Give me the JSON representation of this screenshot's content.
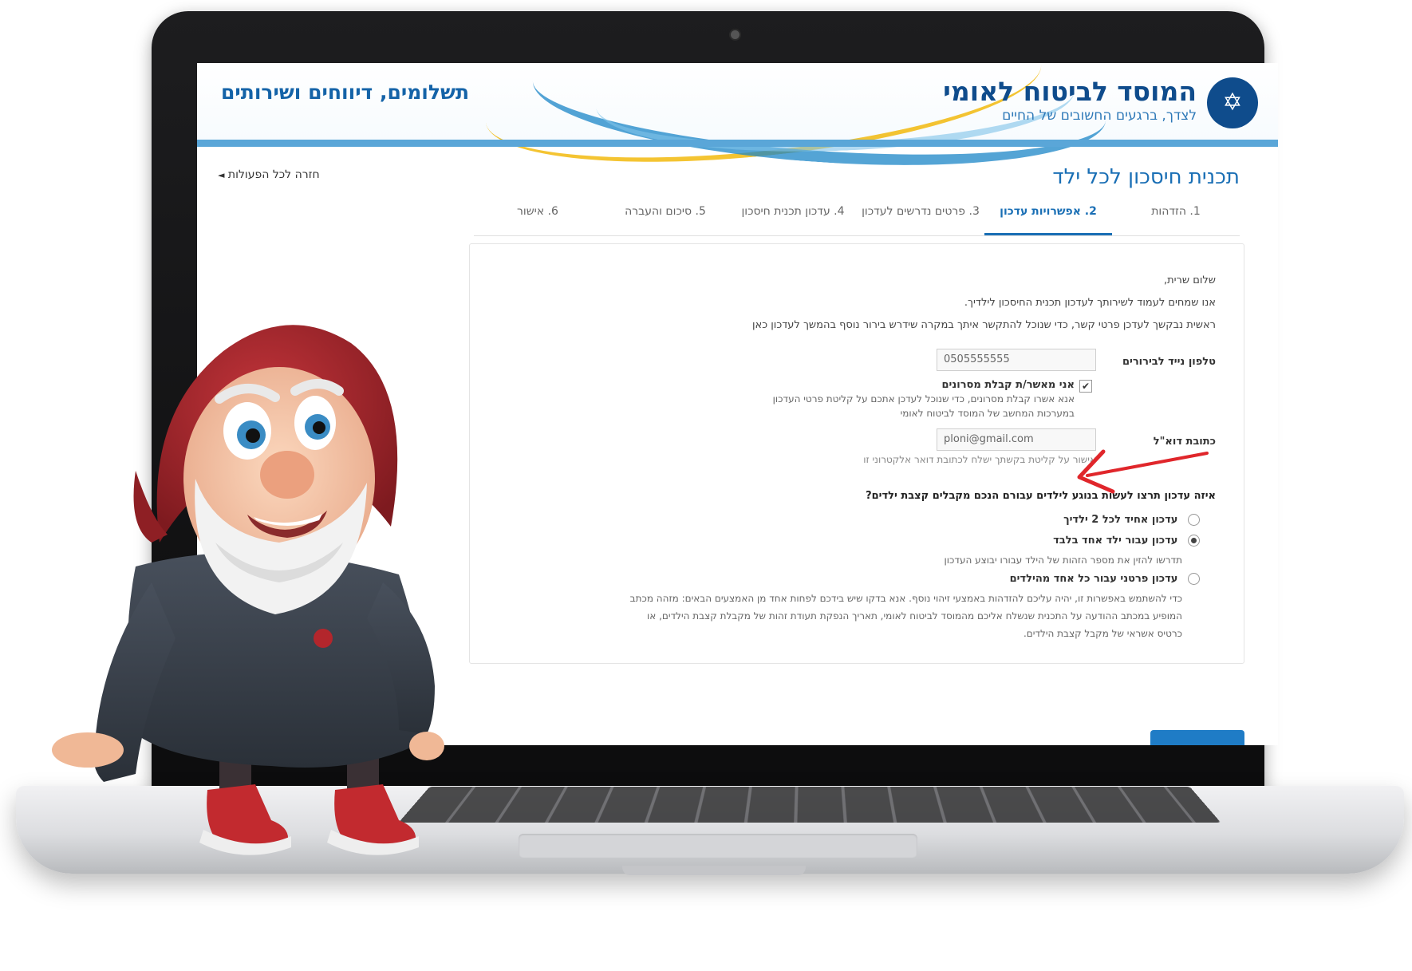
{
  "header": {
    "org_name": "המוסד לביטוח לאומי",
    "org_tagline": "לצדך, ברגעים החשובים של החיים",
    "section_title": "תשלומים, דיווחים ושירותים"
  },
  "page": {
    "title": "תכנית חיסכון לכל ילד",
    "back_link": "חזרה לכל הפעולות"
  },
  "steps": [
    {
      "label": "1. הזדהות"
    },
    {
      "label": "2. אפשרויות עדכון"
    },
    {
      "label": "3. פרטים נדרשים לעדכון"
    },
    {
      "label": "4. עדכון תכנית חיסכון"
    },
    {
      "label": "5. סיכום והעברה"
    },
    {
      "label": "6. אישור"
    }
  ],
  "form": {
    "greeting": "שלום שרית,",
    "intro1": "אנו שמחים לעמוד לשירותך לעדכון תכנית החיסכון לילדיך.",
    "intro2": "ראשית נבקשך לעדכן פרטי קשר, כדי שנוכל להתקשר איתך במקרה שידרש בירור נוסף בהמשך לעדכון כאן",
    "phone_label": "טלפון נייד לבירורים",
    "phone_value": "0505555555",
    "sms_checkbox_label": "אני מאשר/ת קבלת מסרונים",
    "sms_help1": "אנא אשרו קבלת מסרונים, כדי שנוכל לעדכן אתכם על קליטת פרטי העדכון",
    "sms_help2": "במערכות המחשב של המוסד לביטוח לאומי",
    "email_label": "כתובת דוא\"ל",
    "email_value": "ploni@gmail.com",
    "email_help": "אישור על קליטת בקשתך ישלח לכתובת דואר אלקטרוני זו",
    "question": "איזה עדכון תרצו לעשות בנוגע לילדים עבורם הנכם מקבלים קצבת ילדים?",
    "options": [
      {
        "label": "עדכון אחיד לכל 2 ילדיך",
        "selected": false
      },
      {
        "label": "עדכון עבור ילד אחד בלבד",
        "selected": true
      },
      {
        "label": "עדכון פרטני עבור כל אחד מהילדים",
        "selected": false
      }
    ],
    "option2_help": "תדרשו להזין את מספר הזהות של הילד עבורו יבוצע העדכון",
    "option3_help1": "כדי להשתמש באפשרות זו, יהיה עליכם להזדהות באמצעי זיהוי נוסף. אנא בדקו שיש בידכם לפחות אחד מן האמצעים הבאים: מזהה מכתב",
    "option3_help2": "המופיע במכתב ההודעה על התכנית שנשלח אליכם מהמוסד לביטוח לאומי, תאריך הנפקת תעודת זהות של מקבלת קצבת הילדים, או",
    "option3_help3": "כרטיס אשראי של מקבל קצבת הילדים."
  },
  "colors": {
    "brand_blue": "#0f4c8c",
    "accent_blue": "#1a6fb5",
    "arrow_red": "#e0262b"
  }
}
